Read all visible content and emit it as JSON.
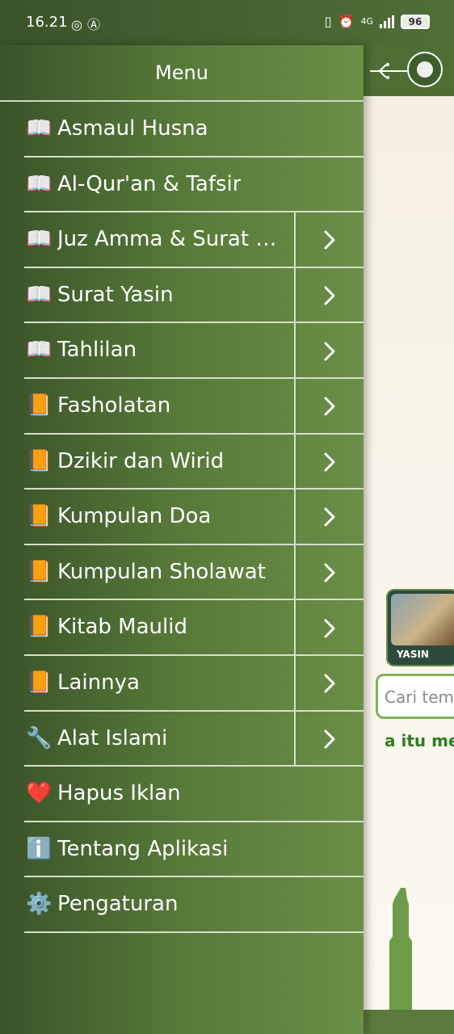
{
  "status_bar": {
    "time": "16.21",
    "left_icons": [
      "instagram-icon",
      "a-circle-icon"
    ],
    "network": "4G",
    "battery": "96"
  },
  "drawer": {
    "title": "Menu",
    "items": [
      {
        "icon": "📖",
        "label": "Asmaul Husna",
        "expandable": false
      },
      {
        "icon": "📖",
        "label": "Al-Qur'an & Tafsir",
        "expandable": false
      },
      {
        "icon": "📖",
        "label": "Juz Amma & Surat Pil...",
        "expandable": true
      },
      {
        "icon": "📖",
        "label": "Surat Yasin",
        "expandable": true
      },
      {
        "icon": "📖",
        "label": "Tahlilan",
        "expandable": true
      },
      {
        "icon": "📙",
        "label": "Fasholatan",
        "expandable": true
      },
      {
        "icon": "📙",
        "label": "Dzikir dan Wirid",
        "expandable": true
      },
      {
        "icon": "📙",
        "label": "Kumpulan Doa",
        "expandable": true
      },
      {
        "icon": "📙",
        "label": "Kumpulan Sholawat",
        "expandable": true
      },
      {
        "icon": "📙",
        "label": "Kitab Maulid",
        "expandable": true
      },
      {
        "icon": "📙",
        "label": "Lainnya",
        "expandable": true
      },
      {
        "icon": "🔧",
        "label": "Alat Islami",
        "expandable": true
      },
      {
        "icon": "❤️",
        "label": "Hapus Iklan",
        "expandable": false
      },
      {
        "icon": "ℹ️",
        "label": "Tentang Aplikasi",
        "expandable": false
      },
      {
        "icon": "⚙️",
        "label": "Pengaturan",
        "expandable": false
      }
    ]
  },
  "background_app": {
    "yasin_card_label": "YASIN",
    "search_placeholder": "Cari tema",
    "teaser_text": "a itu men"
  },
  "colors": {
    "drawer_dark": "#3a5329",
    "drawer_light": "#6a8f47",
    "accent_green": "#2e7d1e"
  }
}
